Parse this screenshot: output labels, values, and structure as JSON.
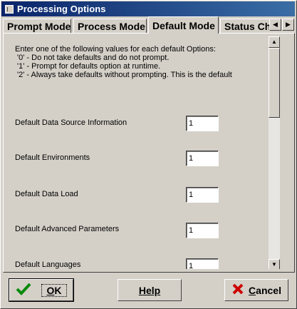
{
  "window": {
    "title": "Processing Options"
  },
  "tabs": [
    {
      "label": "Prompt Mode",
      "active": false
    },
    {
      "label": "Process Mode",
      "active": false
    },
    {
      "label": "Default Mode",
      "active": true
    },
    {
      "label": "Status Ch",
      "active": false
    }
  ],
  "intro": {
    "line1": "Enter one of the following values for each default Options:",
    "line2": " '0' - Do not take defaults and do not prompt.",
    "line3": " '1' - Prompt for defaults option at runtime.",
    "line4": " '2' - Always take defaults without prompting. This is the default"
  },
  "fields": [
    {
      "label": "Default Data Source Information",
      "value": "1"
    },
    {
      "label": "Default Environments",
      "value": "1"
    },
    {
      "label": "Default Data Load",
      "value": "1"
    },
    {
      "label": "Default Advanced Parameters",
      "value": "1"
    },
    {
      "label": "Default Languages",
      "value": "1"
    }
  ],
  "buttons": {
    "ok": {
      "label": "OK",
      "underline": "O",
      "rest": "K"
    },
    "help": {
      "label": "Help"
    },
    "cancel": {
      "label": "Cancel",
      "underline": "C",
      "rest": "ancel"
    }
  },
  "colors": {
    "title_start": "#0a246a",
    "title_end": "#3a6ea5",
    "face": "#d4d0c8",
    "ok_check": "#0a8a0a",
    "cancel_x": "#cc0000"
  },
  "icons": [
    "app-icon",
    "scroll-left-icon",
    "scroll-right-icon",
    "scroll-up-icon",
    "scroll-down-icon",
    "checkmark-icon",
    "x-icon"
  ]
}
